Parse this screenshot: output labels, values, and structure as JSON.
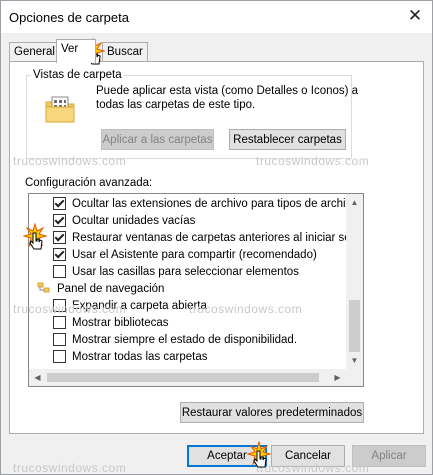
{
  "window": {
    "title": "Opciones de carpeta"
  },
  "tabs": [
    {
      "label": "General"
    },
    {
      "label": "Ver"
    },
    {
      "label": "Buscar"
    }
  ],
  "folder_views": {
    "group_label": "Vistas de carpeta",
    "description_line1": "Puede aplicar esta vista (como Detalles o Iconos) a",
    "description_line2": "todas las carpetas de este tipo.",
    "apply_button": "Aplicar a las carpetas",
    "reset_button": "Restablecer carpetas"
  },
  "advanced": {
    "label": "Configuración avanzada:",
    "items": [
      {
        "text": "Ocultar las extensiones de archivo para tipos de archivo c",
        "checked": true
      },
      {
        "text": "Ocultar unidades vacías",
        "checked": true
      },
      {
        "text": "Restaurar ventanas de carpetas anteriores al iniciar sesió",
        "checked": true
      },
      {
        "text": "Usar el Asistente para compartir (recomendado)",
        "checked": true
      },
      {
        "text": "Usar las casillas para seleccionar elementos",
        "checked": false
      }
    ],
    "nav_pane": {
      "label": "Panel de navegación",
      "items": [
        {
          "text": "Expandir a carpeta abierta",
          "checked": false
        },
        {
          "text": "Mostrar bibliotecas",
          "checked": false
        },
        {
          "text": "Mostrar siempre el estado de disponibilidad.",
          "checked": false
        },
        {
          "text": "Mostrar todas las carpetas",
          "checked": false
        }
      ]
    },
    "restore_defaults_button": "Restaurar valores predeterminados"
  },
  "footer": {
    "ok": "Aceptar",
    "cancel": "Cancelar",
    "apply": "Aplicar"
  },
  "watermark": "trucoswindows.com"
}
